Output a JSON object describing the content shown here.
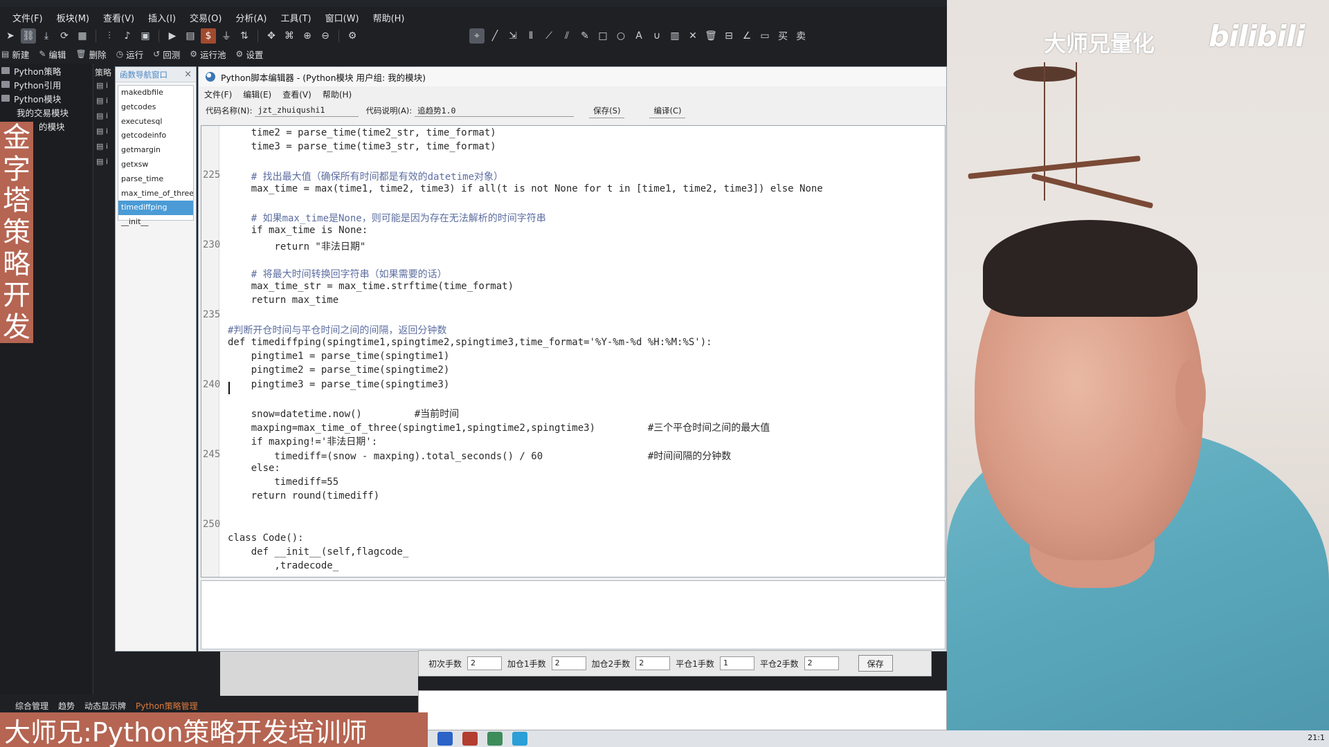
{
  "menubar": [
    "文件(F)",
    "板块(M)",
    "查看(V)",
    "插入(I)",
    "交易(O)",
    "分析(A)",
    "工具(T)",
    "窗口(W)",
    "帮助(H)"
  ],
  "toolbar2": [
    {
      "icon": "new-icon",
      "label": "新建"
    },
    {
      "icon": "edit-icon",
      "label": "编辑"
    },
    {
      "icon": "delete-icon",
      "label": "删除"
    },
    {
      "icon": "run-icon",
      "label": "运行"
    },
    {
      "icon": "backtest-icon",
      "label": "回测"
    },
    {
      "icon": "pool-icon",
      "label": "运行池"
    },
    {
      "icon": "settings-icon",
      "label": "设置"
    }
  ],
  "tree": [
    "Python策略",
    "Python引用",
    "Python模块",
    "我的交易模块",
    "的模块"
  ],
  "strategy_col_head": "策略",
  "vertical_text": [
    "金",
    "字",
    "塔",
    "策",
    "略",
    "开",
    "发"
  ],
  "fnav": {
    "title": "函数导航窗口",
    "close": "×",
    "items": [
      "makedbfile",
      "getcodes",
      "executesql",
      "getcodeinfo",
      "getmargin",
      "getxsw",
      "parse_time",
      "max_time_of_three",
      "timediffping",
      "__init__"
    ],
    "active_index": 8
  },
  "editor": {
    "title": "Python脚本编辑器 - (Python模块 用户组: 我的模块)",
    "menu": [
      "文件(F)",
      "编辑(E)",
      "查看(V)",
      "帮助(H)"
    ],
    "code_name_label": "代码名称(N):",
    "code_name_value": "jzt_zhuiqushi1",
    "code_desc_label": "代码说明(A):",
    "code_desc_value": "追趋势1.0",
    "save_button": "保存(S)",
    "compile_button": "编译(C)"
  },
  "code_lines": [
    {
      "n": "",
      "t": "    time2 = parse_time(time2_str, time_format)"
    },
    {
      "n": "",
      "t": "    time3 = parse_time(time3_str, time_format)"
    },
    {
      "n": "",
      "t": ""
    },
    {
      "n": "225",
      "t": "    # 找出最大值（确保所有时间都是有效的datetime对象）",
      "c": true
    },
    {
      "n": "",
      "t": "    max_time = max(time1, time2, time3) if all(t is not None for t in [time1, time2, time3]) else None"
    },
    {
      "n": "",
      "t": ""
    },
    {
      "n": "",
      "t": "    # 如果max_time是None，则可能是因为存在无法解析的时间字符串",
      "c": true
    },
    {
      "n": "",
      "t": "    if max_time is None:"
    },
    {
      "n": "230",
      "t": "        return \"非法日期\""
    },
    {
      "n": "",
      "t": ""
    },
    {
      "n": "",
      "t": "    # 将最大时间转换回字符串（如果需要的话）",
      "c": true
    },
    {
      "n": "",
      "t": "    max_time_str = max_time.strftime(time_format)"
    },
    {
      "n": "",
      "t": "    return max_time"
    },
    {
      "n": "235",
      "t": ""
    },
    {
      "n": "",
      "t": "#判断开仓时间与平仓时间之间的间隔，返回分钟数",
      "c": true
    },
    {
      "n": "",
      "t": "def timediffping(spingtime1,spingtime2,spingtime3,time_format='%Y-%m-%d %H:%M:%S'):"
    },
    {
      "n": "",
      "t": "    pingtime1 = parse_time(spingtime1)"
    },
    {
      "n": "",
      "t": "    pingtime2 = parse_time(spingtime2)"
    },
    {
      "n": "240",
      "t": "    pingtime3 = parse_time(spingtime3)"
    },
    {
      "n": "",
      "t": ""
    },
    {
      "n": "",
      "t": "    snow=datetime.now()         #当前时间"
    },
    {
      "n": "",
      "t": "    maxping=max_time_of_three(spingtime1,spingtime2,spingtime3)         #三个平仓时间之间的最大值"
    },
    {
      "n": "",
      "t": "    if maxping!='非法日期':"
    },
    {
      "n": "245",
      "t": "        timediff=(snow - maxping).total_seconds() / 60                  #时间间隔的分钟数"
    },
    {
      "n": "",
      "t": "    else:"
    },
    {
      "n": "",
      "t": "        timediff=55"
    },
    {
      "n": "",
      "t": "    return round(timediff)"
    },
    {
      "n": "",
      "t": ""
    },
    {
      "n": "250",
      "t": ""
    },
    {
      "n": "",
      "t": "class Code():"
    },
    {
      "n": "",
      "t": "    def __init__(self,flagcode_"
    },
    {
      "n": "",
      "t": "        ,tradecode_"
    }
  ],
  "params": [
    {
      "label": "初次手数",
      "value": "2"
    },
    {
      "label": "加仓1手数",
      "value": "2"
    },
    {
      "label": "加仓2手数",
      "value": "2"
    },
    {
      "label": "平仓1手数",
      "value": "1"
    },
    {
      "label": "平仓2手数",
      "value": "2"
    }
  ],
  "params_save": "保存",
  "bottom_tabs": [
    "综合管理",
    "趋势",
    "动态显示牌",
    "Python策略管理"
  ],
  "caption": "大师兄:Python策略开发培训师",
  "watermark": "大师兄量化",
  "bili": "bilibili",
  "clock": "21:1"
}
